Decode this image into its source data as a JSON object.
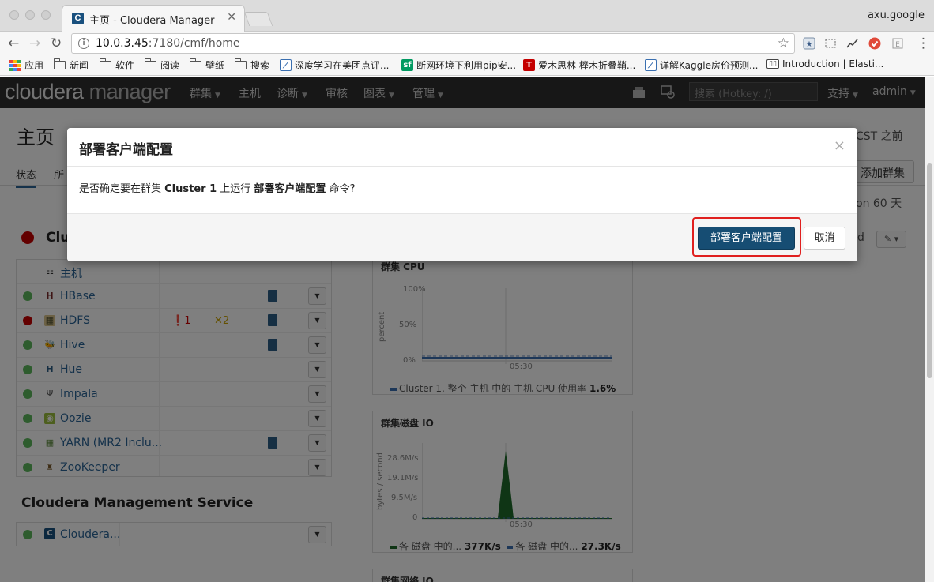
{
  "browser": {
    "tab_title": "主页 - Cloudera Manager",
    "tab_favicon": "C",
    "user": "axu.google",
    "url_host": "10.0.3.45",
    "url_path": ":7180/cmf/home",
    "bookmarks": [
      {
        "label": "应用",
        "icon": "apps-icon"
      },
      {
        "label": "新闻",
        "icon": "folder-icon"
      },
      {
        "label": "软件",
        "icon": "folder-icon"
      },
      {
        "label": "阅读",
        "icon": "folder-icon"
      },
      {
        "label": "壁纸",
        "icon": "folder-icon"
      },
      {
        "label": "搜索",
        "icon": "folder-icon"
      },
      {
        "label": "深度学习在美团点评...",
        "icon": "chart-site-icon"
      },
      {
        "label": "断网环境下利用pip安...",
        "icon": "sf-icon",
        "icon_text": "sf"
      },
      {
        "label": "爱木思林 榉木折叠鞘...",
        "icon": "tmall-icon",
        "icon_text": "T"
      },
      {
        "label": "详解Kaggle房价预测...",
        "icon": "chart-site-icon"
      },
      {
        "label": "Introduction | Elasti...",
        "icon": "book-icon"
      }
    ]
  },
  "cm": {
    "logo_main": "cloudera",
    "logo_sub": "manager",
    "menu": [
      {
        "label": "群集",
        "caret": true
      },
      {
        "label": "主机",
        "caret": false
      },
      {
        "label": "诊断",
        "caret": true
      },
      {
        "label": "审核",
        "caret": false
      },
      {
        "label": "图表",
        "caret": true
      },
      {
        "label": "管理",
        "caret": true
      }
    ],
    "search_placeholder": "搜索 (Hotkey: /)",
    "support": "支持",
    "admin": "admin"
  },
  "page": {
    "title": "主页",
    "time_text": "CST 之前",
    "tabs": [
      "状态",
      "所"
    ],
    "add_cluster": "添加群集",
    "uptime": "on 60 天",
    "cluster_name": "Clu",
    "right_control_text": "d",
    "services": [
      {
        "name": "主机",
        "status": "none",
        "icon": "hosts-icon",
        "doc": false,
        "dropdown": false
      },
      {
        "name": "HBase",
        "status": "good",
        "icon": "hbase-icon",
        "doc": true,
        "dropdown": true
      },
      {
        "name": "HDFS",
        "status": "bad",
        "icon": "hdfs-icon",
        "doc": true,
        "dropdown": true,
        "errors": "1",
        "warnings": "2"
      },
      {
        "name": "Hive",
        "status": "good",
        "icon": "hive-icon",
        "doc": true,
        "dropdown": true
      },
      {
        "name": "Hue",
        "status": "good",
        "icon": "hue-icon",
        "doc": false,
        "dropdown": true
      },
      {
        "name": "Impala",
        "status": "good",
        "icon": "impala-icon",
        "doc": false,
        "dropdown": true
      },
      {
        "name": "Oozie",
        "status": "good",
        "icon": "oozie-icon",
        "doc": false,
        "dropdown": true
      },
      {
        "name": "YARN (MR2 Inclu...",
        "status": "good",
        "icon": "yarn-icon",
        "doc": true,
        "dropdown": true
      },
      {
        "name": "ZooKeeper",
        "status": "good",
        "icon": "zookeeper-icon",
        "doc": false,
        "dropdown": true
      }
    ],
    "mgmt_title": "Cloudera Management Service",
    "mgmt_item": "Cloudera...",
    "colors": {
      "good": "#5cb85c",
      "bad": "#c60000",
      "primary": "#164d73",
      "highlight": "#e0201f"
    }
  },
  "charts": {
    "cpu": {
      "title": "群集 CPU",
      "y_ticks": [
        "100%",
        "50%",
        "0%"
      ],
      "y_label": "percent",
      "x_tick": "05:30",
      "legend": "Cluster 1, 整个 主机 中的 主机 CPU 使用率",
      "legend_value": "1.6%"
    },
    "disk": {
      "title": "群集磁盘 IO",
      "y_ticks": [
        "28.6M/s",
        "19.1M/s",
        "9.5M/s",
        "0"
      ],
      "y_label": "bytes / second",
      "x_tick": "05:30",
      "legend1": "各 磁盘 中的...",
      "legend1_value": "377K/s",
      "legend2": "各 磁盘 中的...",
      "legend2_value": "27.3K/s"
    },
    "network": {
      "title": "群集网络 IO"
    }
  },
  "modal": {
    "title": "部署客户端配置",
    "close": "×",
    "body_prefix": "是否确定要在群集 ",
    "cluster": "Cluster 1",
    "body_mid": " 上运行 ",
    "command": "部署客户端配置",
    "body_suffix": " 命令?",
    "confirm_label": "部署客户端配置",
    "cancel_label": "取消"
  }
}
